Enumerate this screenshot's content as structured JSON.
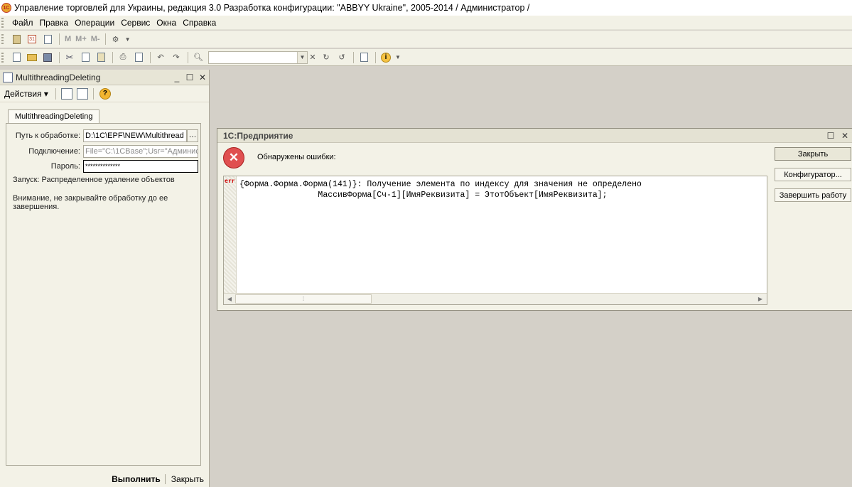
{
  "window": {
    "title": "Управление торговлей для Украины, редакция 3.0 Разработка конфигурации: \"ABBYY Ukraine\", 2005-2014 / Администратор /",
    "logo_text": "1С"
  },
  "menu": [
    {
      "label": "Файл"
    },
    {
      "label": "Правка"
    },
    {
      "label": "Операции"
    },
    {
      "label": "Сервис"
    },
    {
      "label": "Окна"
    },
    {
      "label": "Справка"
    }
  ],
  "toolbar1": {
    "m": "M",
    "mplus": "M+",
    "mminus": "M-",
    "calendar": "31"
  },
  "toolbar2": {
    "search_value": ""
  },
  "left_panel": {
    "title": "MultithreadingDeleting",
    "actions_label": "Действия",
    "tab_label": "MultithreadingDeleting",
    "path_label": "Путь к обработке:",
    "path_value": "D:\\1C\\EPF\\NEW\\Multithread",
    "connection_label": "Подключение:",
    "connection_value": "File=\"C:\\1CBase\";Usr=\"Админис",
    "password_label": "Пароль:",
    "password_value": "**************",
    "launch_text": "Запуск: Распределенное удаление объектов",
    "warning_text": "Внимание, не закрывайте обработку до ее завершения.",
    "run_button": "Выполнить",
    "close_button": "Закрыть"
  },
  "dialog": {
    "title": "1С:Предприятие",
    "message": "Обнаружены ошибки:",
    "err_mark": "err",
    "error_line1": "{Форма.Форма.Форма(141)}: Получение элемента по индексу для значения не определено",
    "error_line2": "                МассивФорма[Сч-1][ИмяРеквизита] = ЭтотОбъект[ИмяРеквизита];",
    "buttons": {
      "close": "Закрыть",
      "configurator": "Конфигуратор...",
      "finish": "Завершить работу"
    }
  },
  "icons": [
    "calculator-icon",
    "calendar-icon",
    "settings-icon",
    "new-doc-icon",
    "open-folder-icon",
    "save-icon",
    "cut-icon",
    "copy-icon",
    "paste-icon",
    "print-icon",
    "preview-icon",
    "undo-icon",
    "redo-icon",
    "search-icon",
    "clear-icon",
    "info-icon",
    "help-icon",
    "error-icon"
  ]
}
